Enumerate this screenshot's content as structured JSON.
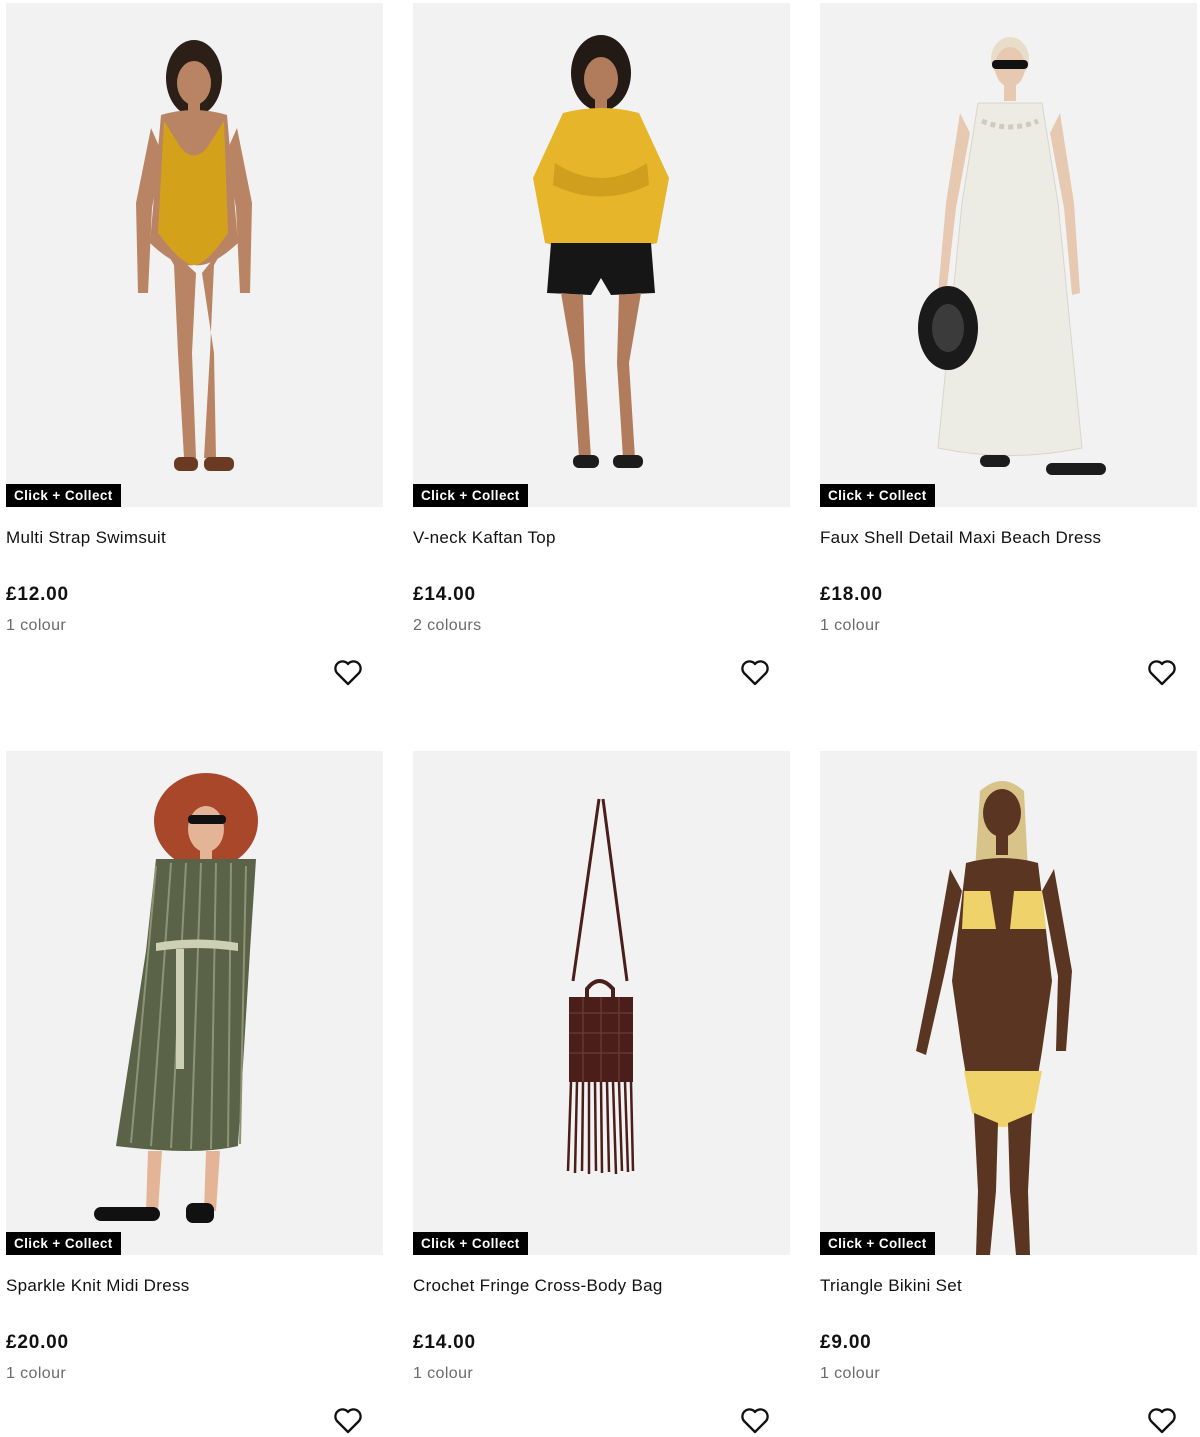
{
  "products": [
    {
      "badge": "Click + Collect",
      "title": "Multi Strap Swimsuit",
      "price": "£12.00",
      "colours": "1 colour",
      "wishlist_icon": "heart-icon"
    },
    {
      "badge": "Click + Collect",
      "title": "V-neck Kaftan Top",
      "price": "£14.00",
      "colours": "2 colours",
      "wishlist_icon": "heart-icon"
    },
    {
      "badge": "Click + Collect",
      "title": "Faux Shell Detail Maxi Beach Dress",
      "price": "£18.00",
      "colours": "1 colour",
      "wishlist_icon": "heart-icon"
    },
    {
      "badge": "Click + Collect",
      "title": "Sparkle Knit Midi Dress",
      "price": "£20.00",
      "colours": "1 colour",
      "wishlist_icon": "heart-icon"
    },
    {
      "badge": "Click + Collect",
      "title": "Crochet Fringe Cross-Body Bag",
      "price": "£14.00",
      "colours": "1 colour",
      "wishlist_icon": "heart-icon"
    },
    {
      "badge": "Click + Collect",
      "title": "Triangle Bikini Set",
      "price": "£9.00",
      "colours": "1 colour",
      "wishlist_icon": "heart-icon"
    }
  ],
  "colors": {
    "badge_bg": "#000000",
    "badge_text": "#ffffff",
    "image_bg": "#f2f2f2",
    "muted_text": "#6a6a6a",
    "swimsuit": "#d4a21a",
    "kaftan": "#e6b52a",
    "maxi_dress": "#ecebe4",
    "knit_dress": "#5a6248",
    "bag": "#4a1e1a",
    "bikini": "#f0d26a"
  }
}
